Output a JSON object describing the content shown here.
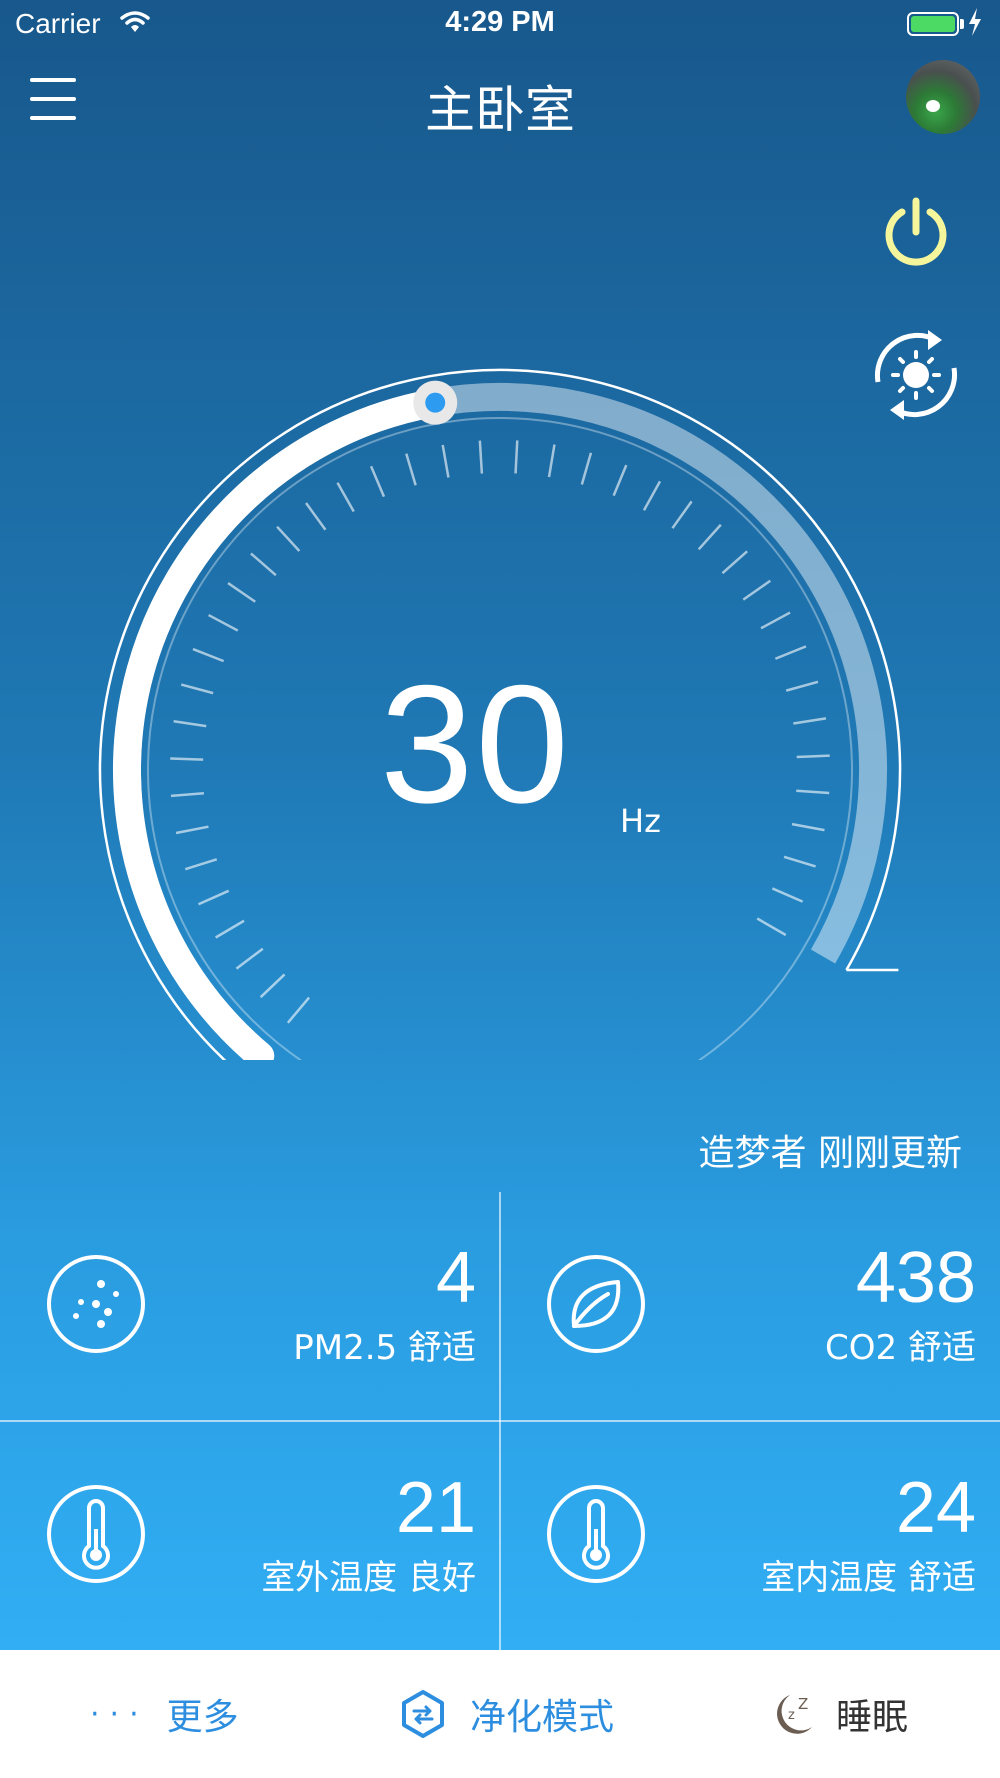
{
  "status_bar": {
    "carrier": "Carrier",
    "time": "4:29 PM",
    "battery_level": 1.0
  },
  "header": {
    "title": "主卧室"
  },
  "gauge": {
    "value": "30",
    "unit": "Hz",
    "min": 0,
    "max": 60
  },
  "update_text": "造梦者 刚刚更新",
  "sensors": [
    {
      "value": "4",
      "label": "PM2.5 舒适",
      "icon": "particles-icon"
    },
    {
      "value": "438",
      "label": "CO2 舒适",
      "icon": "leaf-icon"
    },
    {
      "value": "21",
      "label": "室外温度 良好",
      "icon": "thermometer-icon"
    },
    {
      "value": "24",
      "label": "室内温度 舒适",
      "icon": "thermometer-icon"
    }
  ],
  "bottom_bar": {
    "more_dots": "···",
    "more": "更多",
    "purify": "净化模式",
    "sleep": "睡眠"
  },
  "colors": {
    "accent": "#2d8ee0",
    "power": "#f5f59c",
    "battery": "#4cd964",
    "knob": "#2d9cf0"
  }
}
